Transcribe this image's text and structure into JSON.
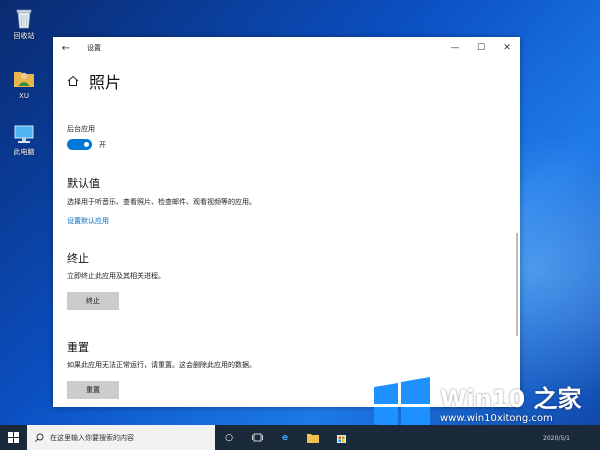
{
  "desktop": {
    "icons": [
      {
        "label": "回收站"
      },
      {
        "label": "XU"
      },
      {
        "label": "此电脑"
      }
    ]
  },
  "window": {
    "title": "设置",
    "controls": {
      "minimize": "—",
      "maximize": "☐",
      "close": "✕"
    }
  },
  "page": {
    "title": "照片",
    "background_apps_label": "后台应用",
    "toggle_state": "开",
    "defaults": {
      "heading": "默认值",
      "desc": "选择用于听音乐、查看照片、检查邮件、观看视频等的应用。",
      "link": "设置默认应用"
    },
    "terminate": {
      "heading": "终止",
      "desc": "立即终止此应用及其相关进程。",
      "button": "终止"
    },
    "reset": {
      "heading": "重置",
      "desc": "如果此应用无法正常运行，请重置。这会删除此应用的数据。",
      "button": "重置"
    }
  },
  "taskbar": {
    "search_placeholder": "在这里输入你要搜索的内容",
    "time": "2020/5/1"
  },
  "watermark": {
    "title": "Win10 之家",
    "url": "www.win10xitong.com"
  },
  "colors": {
    "accent": "#0078d7",
    "link": "#0067c0",
    "button_bg": "#cccccc",
    "taskbar_bg": "#1b2a3a"
  }
}
